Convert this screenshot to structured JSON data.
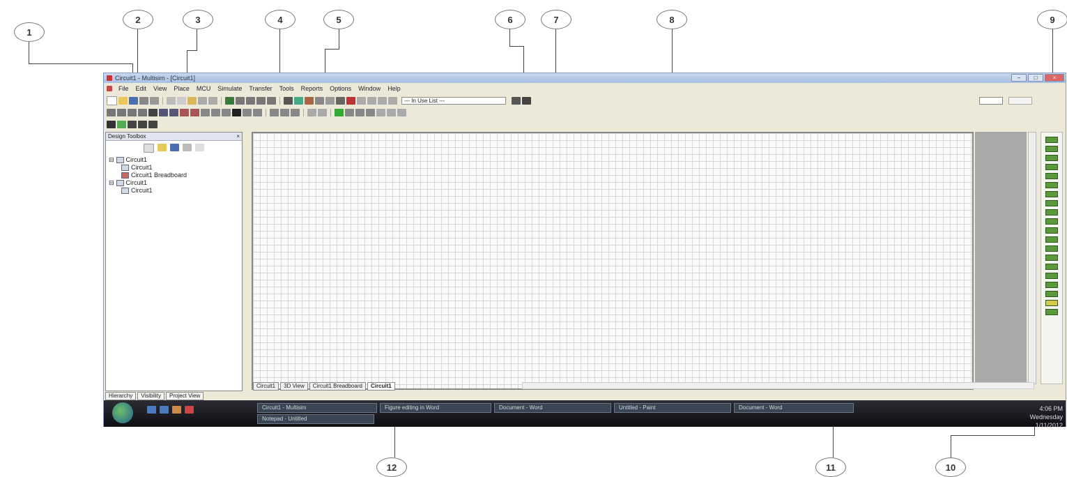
{
  "callouts": [
    "1",
    "2",
    "3",
    "4",
    "5",
    "6",
    "7",
    "8",
    "9",
    "10",
    "11",
    "12"
  ],
  "window": {
    "title": "Circuit1 - Multisim - [Circuit1]"
  },
  "menu": [
    "File",
    "Edit",
    "View",
    "Place",
    "MCU",
    "Simulate",
    "Transfer",
    "Tools",
    "Reports",
    "Options",
    "Window",
    "Help"
  ],
  "toolbar": {
    "in_use_list": "--- In Use List ---"
  },
  "design_toolbox": {
    "title": "Design Toolbox",
    "tree": [
      "Circuit1",
      "Circuit1",
      "Circuit1 Breadboard",
      "Circuit1",
      "Circuit1"
    ],
    "tabs": [
      "Hierarchy",
      "Visibility",
      "Project View"
    ]
  },
  "sheet_tabs": [
    "Circuit1",
    "3D View",
    "Circuit1 Breadboard",
    "Circuit1"
  ],
  "taskbar": {
    "tasks": [
      "Circuit1 - Multisim",
      "Figure editing in Word",
      "Document - Word",
      "Untitled - Paint",
      "Document - Word",
      "Notepad - Untitled"
    ],
    "clock": [
      "4:06 PM",
      "Wednesday",
      "1/11/2012"
    ]
  }
}
